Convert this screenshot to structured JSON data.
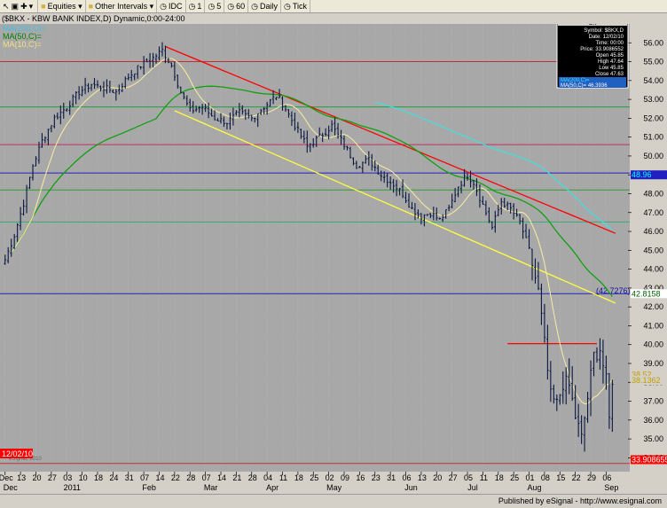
{
  "toolbar": {
    "items": [
      {
        "label": "Equities",
        "icon": "folder-icon"
      },
      {
        "label": "Other Intervals",
        "icon": "folder-icon"
      },
      {
        "label": "IDC",
        "icon": "clock-icon"
      },
      {
        "label": "1",
        "icon": "clock-icon"
      },
      {
        "label": "5",
        "icon": "clock-icon"
      },
      {
        "label": "60",
        "icon": "clock-icon"
      },
      {
        "label": "Daily",
        "icon": "clock-icon"
      },
      {
        "label": "Tick",
        "icon": "clock-icon"
      }
    ]
  },
  "title_bar": "($BKX - KBW BANK INDEX,D) Dynamic,0:00-24:00",
  "legend": {
    "ma200": "MA(200,C)=",
    "ma50": "MA(50,C)=",
    "ma10": "MA(10,C)="
  },
  "cursor_date": "12/02/10",
  "watermark": "eSignal, 2010",
  "footer": "Published by eSignal - http://www.esignal.com",
  "data_box": {
    "header": "OK",
    "symbol": "Symbol: $BKX,D",
    "date": "Date: 12/02/10",
    "time": "Time: 00:00",
    "price": "Price: 33.9086552",
    "open": "Open 45.85",
    "high": "High 47.64",
    "low": "Low 45.85",
    "close": "Close 47.63",
    "ma200": "MA(200,C)=",
    "ma50": "MA(50,C)= 46.3936"
  },
  "chart_data": {
    "type": "ohlc",
    "title": "($BKX - KBW BANK INDEX,D) Dynamic,0:00-24:00",
    "ylim": [
      33.5,
      57.0
    ],
    "y_ticks": [
      34,
      35,
      36,
      37,
      38,
      39,
      40,
      41,
      42,
      43,
      44,
      45,
      46,
      47,
      48,
      49,
      50,
      51,
      52,
      53,
      54,
      55,
      56
    ],
    "x_ticks": [
      {
        "i": 0,
        "l": "Dec"
      },
      {
        "i": 5,
        "l": "13"
      },
      {
        "i": 10,
        "l": "20"
      },
      {
        "i": 15,
        "l": "27"
      },
      {
        "i": 20,
        "l": "03"
      },
      {
        "i": 25,
        "l": "10"
      },
      {
        "i": 30,
        "l": "18"
      },
      {
        "i": 35,
        "l": "24"
      },
      {
        "i": 40,
        "l": "31"
      },
      {
        "i": 45,
        "l": "07"
      },
      {
        "i": 50,
        "l": "14"
      },
      {
        "i": 55,
        "l": "22"
      },
      {
        "i": 60,
        "l": "28"
      },
      {
        "i": 65,
        "l": "07"
      },
      {
        "i": 70,
        "l": "14"
      },
      {
        "i": 75,
        "l": "21"
      },
      {
        "i": 80,
        "l": "28"
      },
      {
        "i": 85,
        "l": "04"
      },
      {
        "i": 90,
        "l": "11"
      },
      {
        "i": 95,
        "l": "18"
      },
      {
        "i": 100,
        "l": "25"
      },
      {
        "i": 105,
        "l": "02"
      },
      {
        "i": 110,
        "l": "09"
      },
      {
        "i": 115,
        "l": "16"
      },
      {
        "i": 120,
        "l": "23"
      },
      {
        "i": 125,
        "l": "31"
      },
      {
        "i": 130,
        "l": "06"
      },
      {
        "i": 135,
        "l": "13"
      },
      {
        "i": 140,
        "l": "20"
      },
      {
        "i": 145,
        "l": "27"
      },
      {
        "i": 150,
        "l": "05"
      },
      {
        "i": 155,
        "l": "11"
      },
      {
        "i": 160,
        "l": "18"
      },
      {
        "i": 165,
        "l": "25"
      },
      {
        "i": 170,
        "l": "01"
      },
      {
        "i": 175,
        "l": "08"
      },
      {
        "i": 180,
        "l": "15"
      },
      {
        "i": 185,
        "l": "22"
      },
      {
        "i": 190,
        "l": "29"
      },
      {
        "i": 195,
        "l": "06"
      }
    ],
    "x_months": [
      {
        "i": 0,
        "l": "Dec"
      },
      {
        "i": 20,
        "l": "2011"
      },
      {
        "i": 45,
        "l": "Feb"
      },
      {
        "i": 65,
        "l": "Mar"
      },
      {
        "i": 85,
        "l": "Apr"
      },
      {
        "i": 105,
        "l": "May"
      },
      {
        "i": 130,
        "l": "Jun"
      },
      {
        "i": 150,
        "l": "Jul"
      },
      {
        "i": 170,
        "l": "Aug"
      },
      {
        "i": 195,
        "l": "Sep"
      }
    ],
    "n_bars": 198,
    "anchors": [
      [
        0,
        44.5
      ],
      [
        3,
        45.8
      ],
      [
        6,
        47.5
      ],
      [
        9,
        49.5
      ],
      [
        12,
        50.8
      ],
      [
        16,
        52.0
      ],
      [
        20,
        52.6
      ],
      [
        24,
        53.4
      ],
      [
        28,
        53.8
      ],
      [
        32,
        53.6
      ],
      [
        36,
        53.4
      ],
      [
        40,
        54.2
      ],
      [
        44,
        54.8
      ],
      [
        48,
        55.2
      ],
      [
        51,
        55.6
      ],
      [
        54,
        54.8
      ],
      [
        57,
        53.4
      ],
      [
        60,
        52.4
      ],
      [
        64,
        52.6
      ],
      [
        68,
        52.0
      ],
      [
        72,
        51.8
      ],
      [
        76,
        52.3
      ],
      [
        80,
        52.0
      ],
      [
        84,
        52.6
      ],
      [
        88,
        53.2
      ],
      [
        90,
        52.8
      ],
      [
        94,
        51.6
      ],
      [
        98,
        50.5
      ],
      [
        102,
        51.0
      ],
      [
        106,
        51.6
      ],
      [
        110,
        50.6
      ],
      [
        114,
        49.5
      ],
      [
        118,
        49.8
      ],
      [
        122,
        49.0
      ],
      [
        126,
        48.5
      ],
      [
        129,
        48.0
      ],
      [
        132,
        47.2
      ],
      [
        135,
        46.8
      ],
      [
        138,
        47.0
      ],
      [
        141,
        46.6
      ],
      [
        144,
        47.2
      ],
      [
        147,
        48.4
      ],
      [
        150,
        49.0
      ],
      [
        152,
        48.6
      ],
      [
        155,
        47.4
      ],
      [
        158,
        46.2
      ],
      [
        161,
        47.6
      ],
      [
        164,
        47.2
      ],
      [
        167,
        46.5
      ],
      [
        170,
        45.0
      ],
      [
        173,
        42.8
      ],
      [
        175,
        40.0
      ],
      [
        177,
        37.2
      ],
      [
        179,
        36.8
      ],
      [
        181,
        38.0
      ],
      [
        183,
        37.8
      ],
      [
        185,
        36.2
      ],
      [
        187,
        35.0
      ],
      [
        189,
        37.2
      ],
      [
        191,
        39.4
      ],
      [
        193,
        39.8
      ],
      [
        195,
        38.0
      ],
      [
        196,
        36.0
      ],
      [
        197,
        38.2
      ]
    ],
    "ma_values": {
      "ma50_last": "42.8158",
      "ma10_last": "38.1362"
    },
    "horizontal_lines": [
      {
        "y": 55.0,
        "color": "#c03030"
      },
      {
        "y": 52.6,
        "color": "#20a040"
      },
      {
        "y": 50.6,
        "color": "#c03060"
      },
      {
        "y": 49.1,
        "color": "#2020c0"
      },
      {
        "y": 48.2,
        "color": "#30a030"
      },
      {
        "y": 46.5,
        "color": "#30b070"
      },
      {
        "y": 42.7,
        "color": "#2020c0"
      },
      {
        "y": 33.7,
        "color": "#c03030"
      }
    ],
    "price_labels": [
      {
        "y": 49.0,
        "text": "48.96",
        "bg": "#2020c0",
        "fg": "#00ffff"
      },
      {
        "y": 42.7,
        "text": "42.8158",
        "bg": "#ffffff",
        "fg": "#006000"
      },
      {
        "y": 38.4,
        "text": "38.52",
        "bg": "#d4d0c8",
        "fg": "#c0a000"
      },
      {
        "y": 38.1,
        "text": "38.1362",
        "bg": "#d4d0c8",
        "fg": "#c0a000"
      },
      {
        "y": 33.9,
        "text": "33.9086552",
        "bg": "#ff0000",
        "fg": "#ffffff"
      }
    ],
    "level_annotation": {
      "text": "(42.7276)",
      "y": 42.85
    },
    "trendlines": [
      {
        "color": "#ff0000",
        "from": [
          52,
          55.8
        ],
        "to": [
          198,
          45.9
        ]
      },
      {
        "color": "#ffff40",
        "from": [
          55,
          52.4
        ],
        "to": [
          198,
          42.2
        ]
      }
    ],
    "resistance": {
      "color": "#ff0000",
      "y": 40.05,
      "from": 163,
      "to": 192
    }
  }
}
